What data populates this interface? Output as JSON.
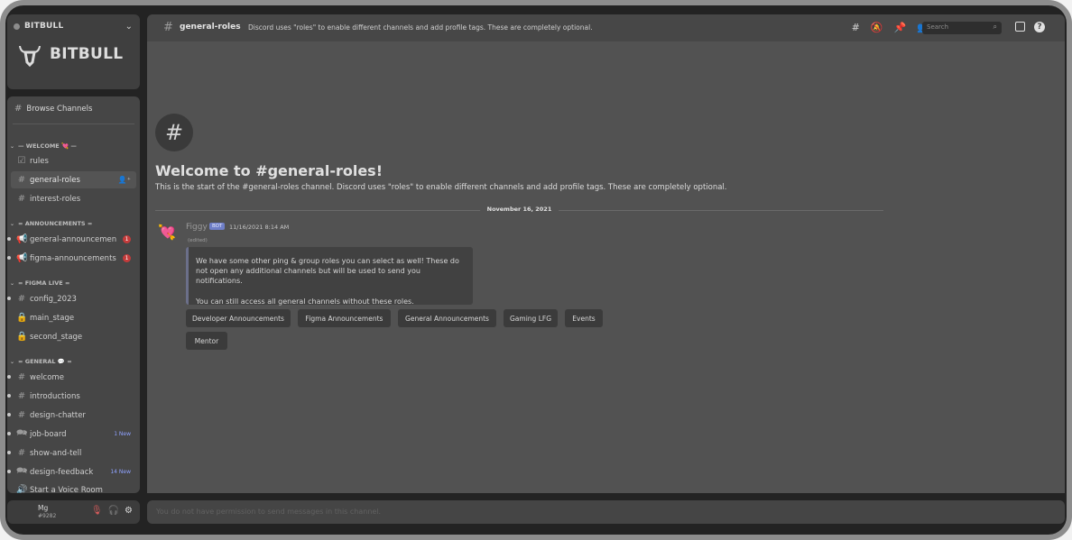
{
  "server": {
    "name": "BITBULL",
    "logo_text": "BITBULL"
  },
  "sidebar": {
    "browse_label": "Browse Channels",
    "categories": [
      {
        "label": "— WELCOME 💘 —"
      },
      {
        "label": "= ANNOUNCEMENTS ="
      },
      {
        "label": "= FIGMA LIVE ="
      },
      {
        "label": "= GENERAL 💬 ="
      }
    ],
    "channels": [
      {
        "name": "rules"
      },
      {
        "name": "general-roles"
      },
      {
        "name": "interest-roles"
      },
      {
        "name": "general-announcemen",
        "badge": "1"
      },
      {
        "name": "figma-announcements",
        "badge": "1"
      },
      {
        "name": "config_2023"
      },
      {
        "name": "main_stage"
      },
      {
        "name": "second_stage"
      },
      {
        "name": "welcome"
      },
      {
        "name": "introductions"
      },
      {
        "name": "design-chatter"
      },
      {
        "name": "job-board",
        "tag": "1 New"
      },
      {
        "name": "show-and-tell"
      },
      {
        "name": "design-feedback",
        "tag": "14 New"
      },
      {
        "name": "Start a Voice Room"
      }
    ]
  },
  "user": {
    "name": "Mg",
    "discriminator": "#9282"
  },
  "topbar": {
    "channel": "general-roles",
    "topic": "Discord uses \"roles\" to enable different channels and add profile tags. These are completely optional.",
    "search_placeholder": "Search",
    "help": "?"
  },
  "main": {
    "welcome_title": "Welcome to #general-roles!",
    "welcome_sub": "This is the start of the #general-roles channel. Discord uses \"roles\" to enable different channels and add profile tags. These are completely optional.",
    "date": "November 16, 2021",
    "message": {
      "author": "Figgy",
      "bot_tag": "BOT",
      "time": "11/16/2021 8:14 AM",
      "edited": "(edited)",
      "embed_p1": "We have some other ping & group roles you can select as well! These do not open any additional channels but will be used to send you notifications.",
      "embed_p2": "You can still access all general channels without these roles."
    },
    "role_buttons": [
      "Developer Announcements",
      "Figma Announcements",
      "General Announcements",
      "Gaming LFG",
      "Events",
      "Mentor"
    ],
    "composer_placeholder": "You do not have permission to send messages in this channel."
  },
  "colors": {
    "accent_bot_tag": "#6f7fc8",
    "badge_red": "#c43b3b",
    "new_tag": "#8fa2ff"
  }
}
